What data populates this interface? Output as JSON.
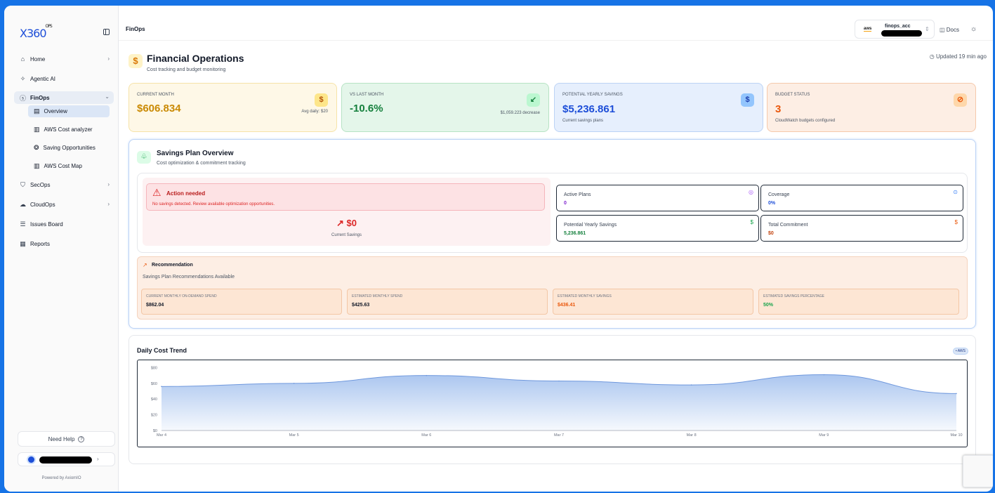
{
  "app": {
    "logo_text": "X360",
    "logo_sup": "OPS",
    "powered_by": "Powered by AxiomIO"
  },
  "sidebar": {
    "items": [
      {
        "label": "Home",
        "icon": "home-icon",
        "chevron": "›"
      },
      {
        "label": "Agentic AI",
        "icon": "sparkle-icon"
      },
      {
        "label": "FinOps",
        "icon": "dollar-circle-icon",
        "chevron": "⌄"
      },
      {
        "label": "SecOps",
        "icon": "shield-icon",
        "chevron": "›"
      },
      {
        "label": "CloudOps",
        "icon": "cloud-icon",
        "chevron": "›"
      },
      {
        "label": "Issues Board",
        "icon": "board-icon"
      },
      {
        "label": "Reports",
        "icon": "report-icon"
      }
    ],
    "finops_sub": [
      {
        "label": "Overview",
        "icon": "overview-icon"
      },
      {
        "label": "AWS Cost analyzer",
        "icon": "chart-icon"
      },
      {
        "label": "Saving Opportunities",
        "icon": "coins-icon"
      },
      {
        "label": "AWS Cost Map",
        "icon": "map-icon"
      }
    ],
    "help_label": "Need Help",
    "help_icon": "?"
  },
  "topbar": {
    "breadcrumb": "FinOps",
    "account_provider": "aws",
    "account_name": "finops_acc",
    "docs_label": "Docs"
  },
  "page": {
    "title": "Financial Operations",
    "subtitle": "Cost tracking and budget monitoring",
    "updated": "Updated 19 min ago"
  },
  "cards": [
    {
      "label": "CURRENT MONTH",
      "value": "$606.834",
      "note": "Avg daily: $20",
      "icon": "$",
      "color": "#ca8a04"
    },
    {
      "label": "VS LAST MONTH",
      "value": "-10.6%",
      "note": "$1,059.223 decrease",
      "icon": "↙",
      "color": "#15803d"
    },
    {
      "label": "POTENTIAL YEARLY SAVINGS",
      "value": "$5,236.861",
      "note": "Current savings plans",
      "icon": "$",
      "color": "#1d4ed8"
    },
    {
      "label": "BUDGET STATUS",
      "value": "3",
      "note": "CloudWatch budgets configured",
      "icon": "⊘",
      "color": "#ea580c"
    }
  ],
  "savings_plan": {
    "title": "Savings Plan Overview",
    "subtitle": "Cost optimization & commitment tracking",
    "alert_title": "Action needed",
    "alert_desc": "No savings detected. Review available optimization opportunities.",
    "current_savings": "$0",
    "current_savings_label": "Current Savings",
    "metrics": [
      {
        "label": "Active Plans",
        "value": "0",
        "color": "#7e22ce",
        "icon": "◎",
        "icon_color": "#a855f7"
      },
      {
        "label": "Coverage",
        "value": "0%",
        "color": "#1d4ed8",
        "icon": "⊙",
        "icon_color": "#3b82f6"
      },
      {
        "label": "Potential Yearly Savings",
        "value": "5,236.861",
        "color": "#15803d",
        "icon": "$",
        "icon_color": "#16a34a"
      },
      {
        "label": "Total Commitment",
        "value": "$0",
        "color": "#c2410c",
        "icon": "$",
        "icon_color": "#ea580c"
      }
    ]
  },
  "recommendation": {
    "title": "Recommendation",
    "subtitle": "Savings Plan Recommendations Available",
    "boxes": [
      {
        "label": "CURRENT MONTHLY ON-DEMAND SPEND",
        "value": "$862.04",
        "color": "#111827"
      },
      {
        "label": "ESTIMATED MONTHLY SPEND",
        "value": "$425.63",
        "color": "#111827"
      },
      {
        "label": "ESTIMATED MONTHLY SAVINGS",
        "value": "$436.41",
        "color": "#ea580c"
      },
      {
        "label": "ESTIMATED SAVINGS PERCENTAGE",
        "value": "50%",
        "color": "#16a34a"
      }
    ]
  },
  "trend": {
    "title": "Daily Cost Trend",
    "tag": "• AWS"
  },
  "chart_data": {
    "type": "area",
    "title": "Daily Cost Trend",
    "x": [
      "Mar 4",
      "Mar 5",
      "Mar 6",
      "Mar 7",
      "Mar 8",
      "Mar 9",
      "Mar 10"
    ],
    "series": [
      {
        "values": [
          56,
          60,
          70,
          63,
          58,
          71,
          47
        ]
      }
    ],
    "y_ticks": [
      "$0",
      "$20",
      "$40",
      "$60",
      "$80"
    ],
    "ylim": [
      0,
      84
    ],
    "color": "#8fb3ea",
    "grid": false
  }
}
